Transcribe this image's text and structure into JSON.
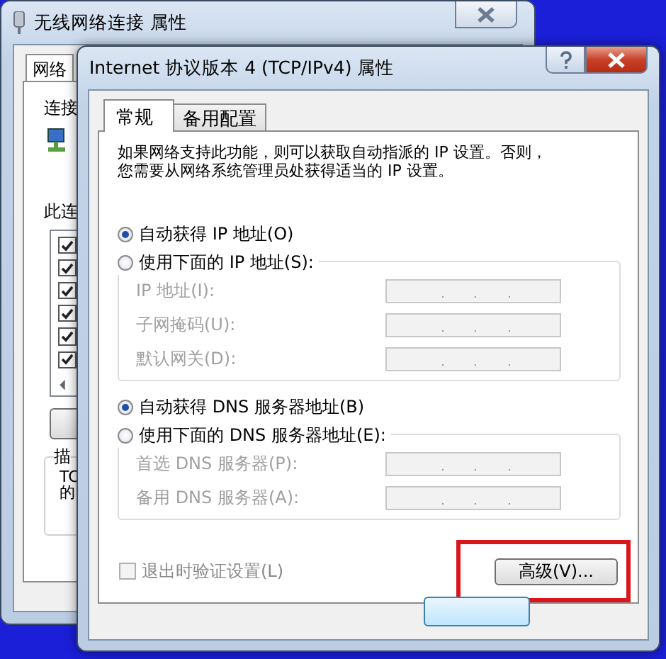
{
  "background_window": {
    "title": "无线网络连接 属性",
    "tab": "网络",
    "connect_label": "连接",
    "components_label": "此连",
    "components": [
      {
        "checked": true
      },
      {
        "checked": true
      },
      {
        "checked": true
      },
      {
        "checked": true
      },
      {
        "checked": true
      },
      {
        "checked": true
      }
    ],
    "description_label": "描",
    "description_lines": [
      "TC",
      "的"
    ]
  },
  "dialog": {
    "title": "Internet 协议版本 4 (TCP/IPv4) 属性",
    "tabs": [
      {
        "label": "常规",
        "selected": true
      },
      {
        "label": "备用配置",
        "selected": false
      }
    ],
    "description_lines": [
      "如果网络支持此功能，则可以获取自动指派的 IP 设置。否则，",
      "您需要从网络系统管理员处获得适当的 IP 设置。"
    ],
    "ip_options": [
      {
        "label": "自动获得 IP 地址(O)",
        "selected": true
      },
      {
        "label": "使用下面的 IP 地址(S):",
        "selected": false
      }
    ],
    "ip_fields": [
      {
        "label": "IP 地址(I):",
        "disabled": true
      },
      {
        "label": "子网掩码(U):",
        "disabled": true
      },
      {
        "label": "默认网关(D):",
        "disabled": true
      }
    ],
    "dns_options": [
      {
        "label": "自动获得 DNS 服务器地址(B)",
        "selected": true
      },
      {
        "label": "使用下面的 DNS 服务器地址(E):",
        "selected": false
      }
    ],
    "dns_fields": [
      {
        "label": "首选 DNS 服务器(P):",
        "disabled": true
      },
      {
        "label": "备用 DNS 服务器(A):",
        "disabled": true
      }
    ],
    "validate_checkbox": {
      "label": "退出时验证设置(L)",
      "checked": false,
      "disabled": true
    },
    "advanced_button": {
      "label": "高级(V)...",
      "highlighted": true
    }
  }
}
